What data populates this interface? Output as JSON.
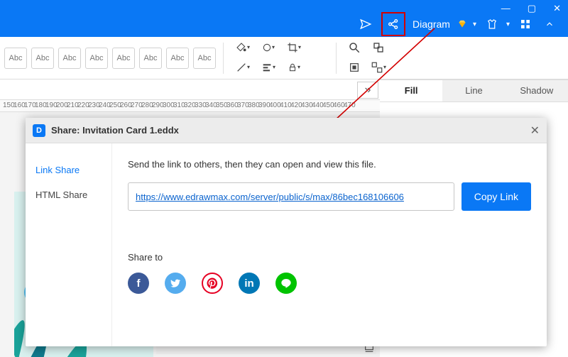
{
  "titlebar": {
    "diagram_label": "Diagram",
    "win": {
      "min": "—",
      "max": "▢",
      "close": "✕"
    }
  },
  "abc_label": "Abc",
  "right_tabs": {
    "fill": "Fill",
    "line": "Line",
    "shadow": "Shadow"
  },
  "ruler_ticks": [
    "150",
    "160",
    "170",
    "180",
    "190",
    "200",
    "210",
    "220",
    "230",
    "240",
    "250",
    "260",
    "270",
    "280",
    "290",
    "300",
    "310",
    "320",
    "330",
    "340",
    "350",
    "360",
    "370",
    "380",
    "390",
    "400",
    "410",
    "420",
    "430",
    "440",
    "450",
    "460",
    "470"
  ],
  "dialog": {
    "title": "Share: Invitation Card 1.eddx",
    "tabs": {
      "link": "Link Share",
      "html": "HTML Share"
    },
    "desc": "Send the link to others, then they can open and view this file.",
    "link_url": "https://www.edrawmax.com/server/public/s/max/86bec168106606",
    "copy_label": "Copy Link",
    "share_to": "Share to",
    "socials": {
      "fb": "f",
      "tw": "t",
      "pn": "p",
      "li": "in",
      "ln": "L"
    }
  }
}
